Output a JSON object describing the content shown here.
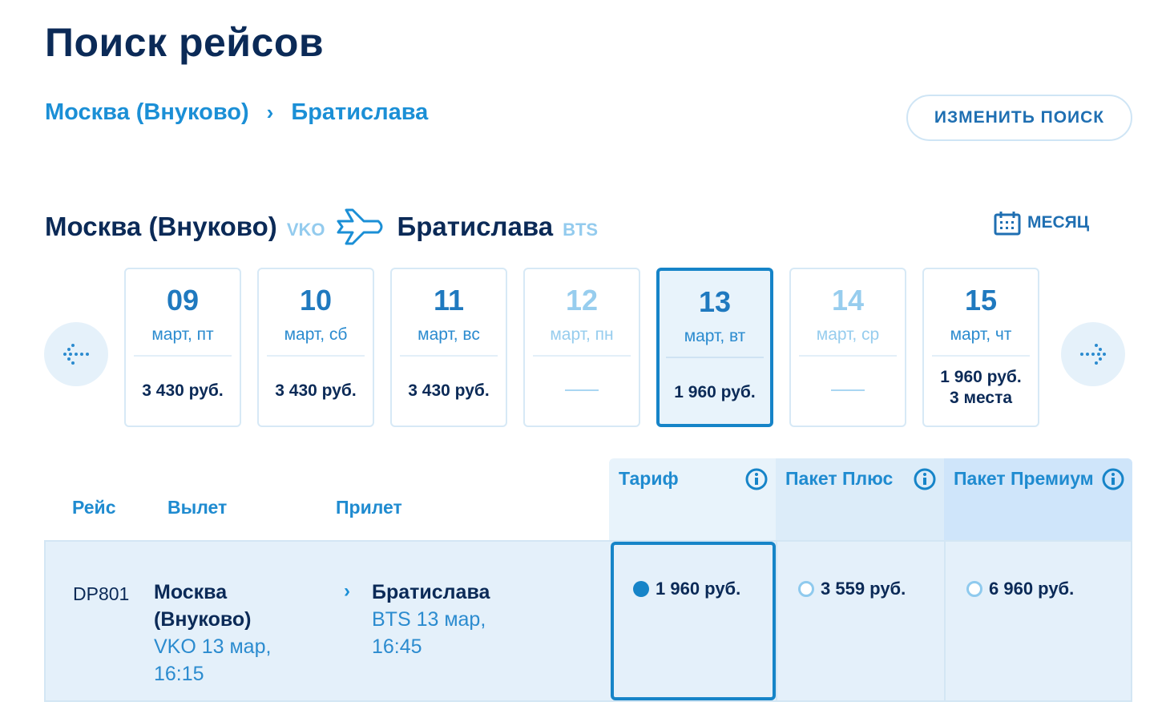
{
  "title": "Поиск рейсов",
  "route": {
    "from": "Москва (Внуково)",
    "separator": "›",
    "to": "Братислава"
  },
  "change_search_label": "ИЗМЕНИТЬ ПОИСК",
  "direction": {
    "from_city": "Москва (Внуково)",
    "from_code": "VKO",
    "to_city": "Братислава",
    "to_code": "BTS"
  },
  "month_label": "МЕСЯЦ",
  "dates": [
    {
      "day": "09",
      "weekday": "март, пт",
      "price": "3 430 руб."
    },
    {
      "day": "10",
      "weekday": "март, сб",
      "price": "3 430 руб."
    },
    {
      "day": "11",
      "weekday": "март, вс",
      "price": "3 430 руб."
    },
    {
      "day": "12",
      "weekday": "март, пн",
      "price": ""
    },
    {
      "day": "13",
      "weekday": "март, вт",
      "price": "1 960 руб."
    },
    {
      "day": "14",
      "weekday": "март, ср",
      "price": ""
    },
    {
      "day": "15",
      "weekday": "март, чт",
      "price": "1 960 руб.",
      "seats": "3 места"
    }
  ],
  "columns": {
    "flight": "Рейс",
    "departure": "Вылет",
    "arrival": "Прилет"
  },
  "fares": [
    {
      "name": "Тариф"
    },
    {
      "name": "Пакет Плюс"
    },
    {
      "name": "Пакет Премиум"
    }
  ],
  "flight": {
    "number": "DP801",
    "dep_city_1": "Москва",
    "dep_city_2": "(Внуково)",
    "dep_info_1": "VKO 13 мар,",
    "dep_info_2": "16:15",
    "arr_city": "Братислава",
    "arr_info_1": "BTS 13 мар,",
    "arr_info_2": "16:45",
    "prices": [
      "1 960 руб.",
      "3 559 руб.",
      "6 960 руб."
    ]
  },
  "colors": {
    "accent": "#1684c8",
    "dark": "#0b2a57",
    "light": "#e4f0fa"
  }
}
